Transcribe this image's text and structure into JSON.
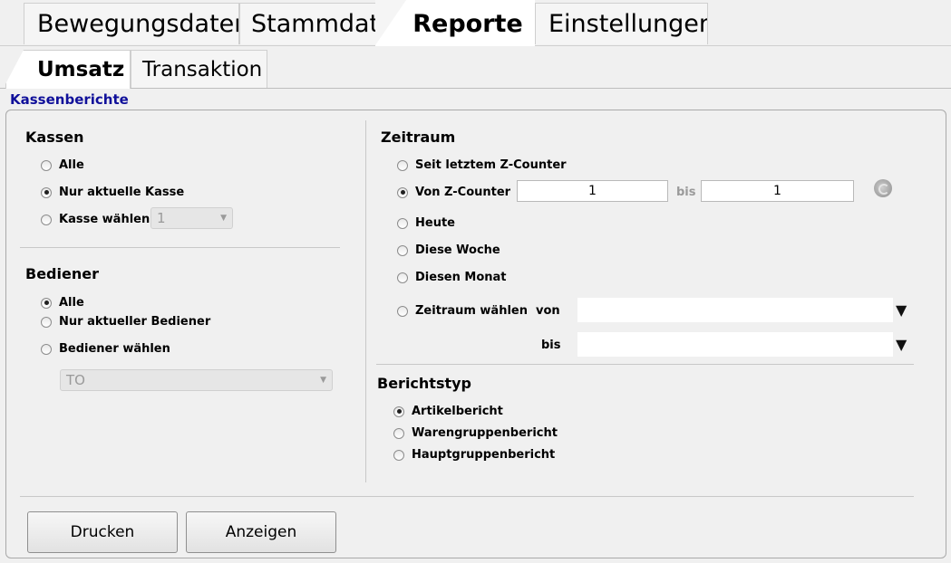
{
  "tabs_main": [
    {
      "label": "Bewegungsdaten"
    },
    {
      "label": "Stammdaten"
    },
    {
      "label": "Reporte",
      "active": true
    },
    {
      "label": "Einstellungen"
    }
  ],
  "tabs_sub": [
    {
      "label": "Umsatz",
      "active": true
    },
    {
      "label": "Transaktion"
    }
  ],
  "section_title": "Kassenberichte",
  "kassen": {
    "header": "Kassen",
    "options": [
      "Alle",
      "Nur aktuelle Kasse",
      "Kasse wählen"
    ],
    "selected_index": 1,
    "combo_value": "1"
  },
  "bediener": {
    "header": "Bediener",
    "options": [
      "Alle",
      "Nur aktueller Bediener",
      "Bediener wählen"
    ],
    "selected_index": 0,
    "combo_value": "TO"
  },
  "zeitraum": {
    "header": "Zeitraum",
    "options": [
      "Seit letztem Z-Counter",
      "Von Z-Counter",
      "Heute",
      "Diese Woche",
      "Diesen Monat",
      "Zeitraum wählen"
    ],
    "selected_index": 1,
    "z_from": "1",
    "z_bis_label": "bis",
    "z_to": "1",
    "von_label": "von",
    "bis_label": "bis",
    "von_value": "",
    "bis_value": ""
  },
  "berichtstyp": {
    "header": "Berichtstyp",
    "options": [
      "Artikelbericht",
      "Warengruppenbericht",
      "Hauptgruppenbericht"
    ],
    "selected_index": 0
  },
  "buttons": {
    "print": "Drucken",
    "show": "Anzeigen"
  }
}
